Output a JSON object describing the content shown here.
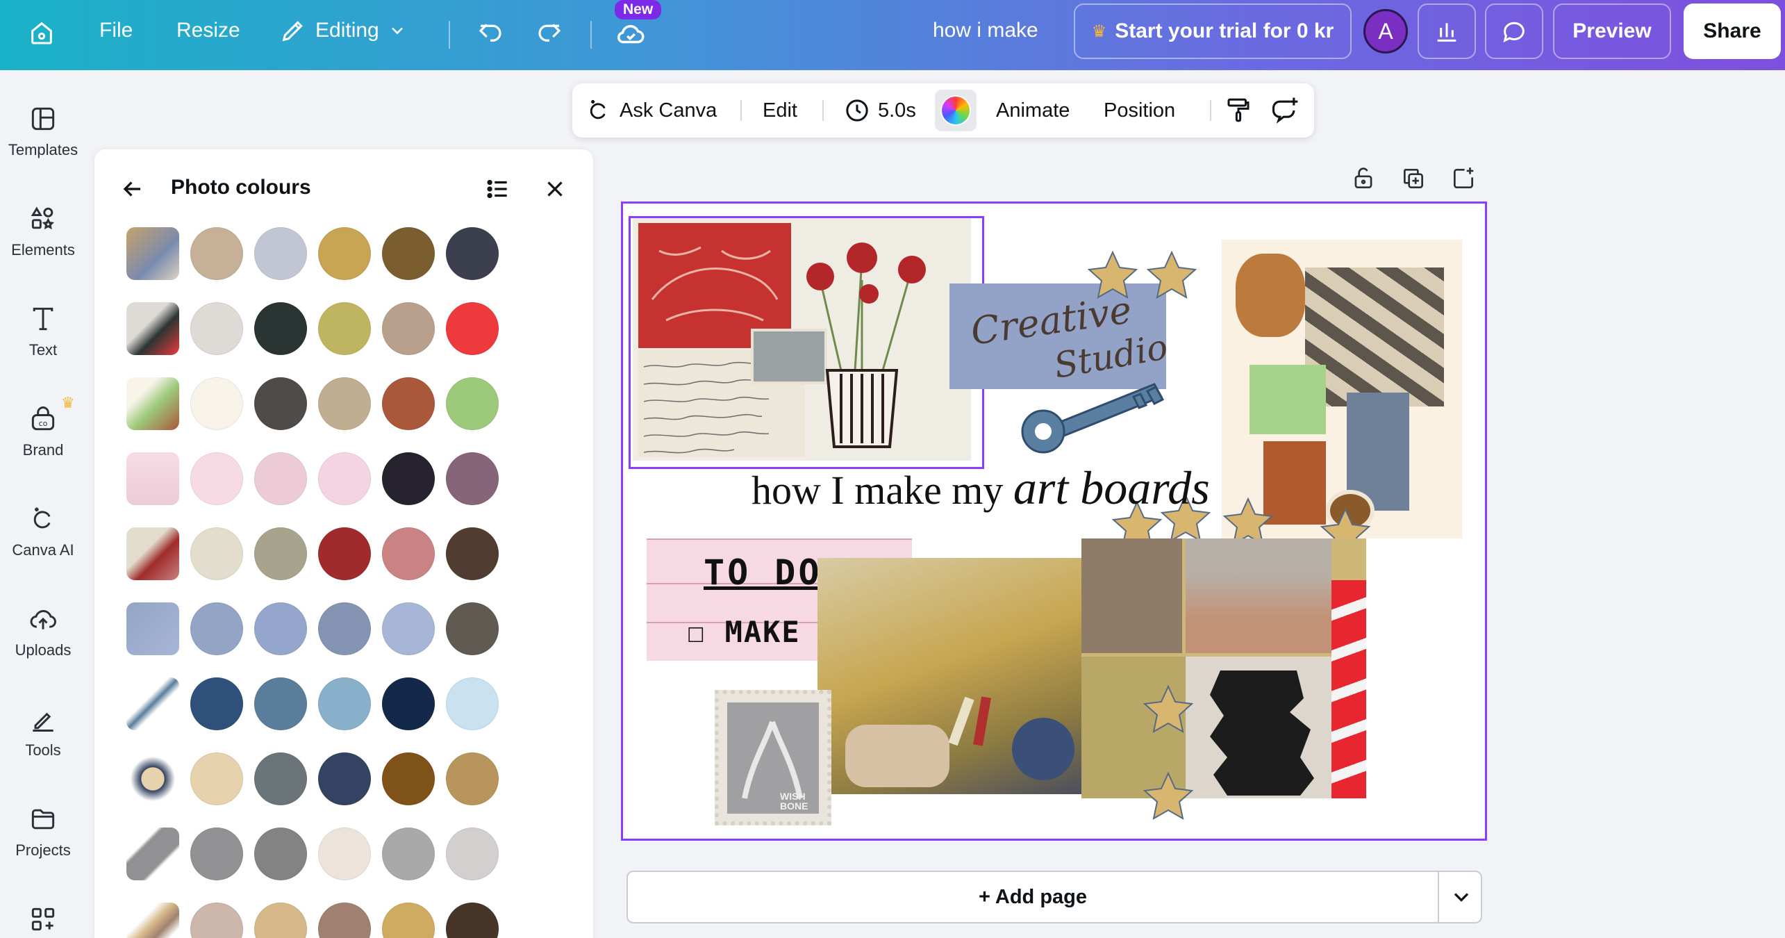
{
  "topbar": {
    "file": "File",
    "resize": "Resize",
    "editing": "Editing",
    "new_badge": "New",
    "doc_title": "how i make",
    "trial": "Start your trial for 0 kr",
    "avatar": "A",
    "preview": "Preview",
    "share": "Share"
  },
  "rail": {
    "items": [
      {
        "label": "Templates",
        "icon": "templates-icon"
      },
      {
        "label": "Elements",
        "icon": "elements-icon"
      },
      {
        "label": "Text",
        "icon": "text-icon"
      },
      {
        "label": "Brand",
        "icon": "brand-icon"
      },
      {
        "label": "Canva AI",
        "icon": "canva-ai-icon"
      },
      {
        "label": "Uploads",
        "icon": "uploads-icon"
      },
      {
        "label": "Tools",
        "icon": "tools-icon"
      },
      {
        "label": "Projects",
        "icon": "projects-icon"
      },
      {
        "label": "",
        "icon": "apps-icon"
      }
    ]
  },
  "panel": {
    "title": "Photo colours",
    "rows": [
      {
        "thumb": "thumb-collage-1",
        "colors": [
          "#c6b097",
          "#c2c6d3",
          "#c7a553",
          "#7a5e30",
          "#3c3f4e"
        ]
      },
      {
        "thumb": "thumb-collage-2",
        "colors": [
          "#dedad6",
          "#2a3433",
          "#bfb45f",
          "#b8a08d",
          "#ee3a3c"
        ]
      },
      {
        "thumb": "thumb-collage-3",
        "colors": [
          "#f7f3e9",
          "#4e4b49",
          "#c0ae92",
          "#a9583a",
          "#9dc97a"
        ]
      },
      {
        "thumb": "thumb-todo",
        "colors": [
          "#f6dbe5",
          "#eccbd7",
          "#f4d4e2",
          "#26232f",
          "#876578"
        ]
      },
      {
        "thumb": "thumb-collage-4",
        "colors": [
          "#e2ddcc",
          "#a8a38c",
          "#a02a2c",
          "#c98382",
          "#513c32"
        ]
      },
      {
        "thumb": "thumb-creative-studio",
        "colors": [
          "#93a4c4",
          "#94a6cb",
          "#8594b2",
          "#a7b6d6",
          "#615a52"
        ]
      },
      {
        "thumb": "thumb-key",
        "colors": [
          "#2e507a",
          "#5a7d9b",
          "#89b0ca",
          "#14294a",
          "#c9e1f0"
        ]
      },
      {
        "thumb": "thumb-star",
        "colors": [
          "#e6d2ad",
          "#6b7479",
          "#334361",
          "#7e5219",
          "#b8955c"
        ]
      },
      {
        "thumb": "thumb-stamp",
        "colors": [
          "#919193",
          "#838384",
          "#ece4db",
          "#a9a9aa",
          "#d2cfce"
        ]
      },
      {
        "thumb": "thumb-stars",
        "colors": [
          "#cdb6ab",
          "#d6b88a",
          "#a08070",
          "#cfaa61",
          "#48352a"
        ]
      }
    ]
  },
  "toolbar": {
    "ask_canva": "Ask Canva",
    "edit": "Edit",
    "duration": "5.0s",
    "animate": "Animate",
    "position": "Position"
  },
  "artboard": {
    "title_plain": "how I make my ",
    "title_italic": "art boards",
    "creative_line1": "Creative",
    "creative_line2": "Studio",
    "todo": "TO DO:",
    "make_art": "☐ MAKE ART",
    "stamp": "WISH BONE"
  },
  "add_page": "+ Add page",
  "colors": {
    "accent": "#8b3dff",
    "gradient_start": "#1ab2c8",
    "gradient_end": "#7e4fde"
  }
}
